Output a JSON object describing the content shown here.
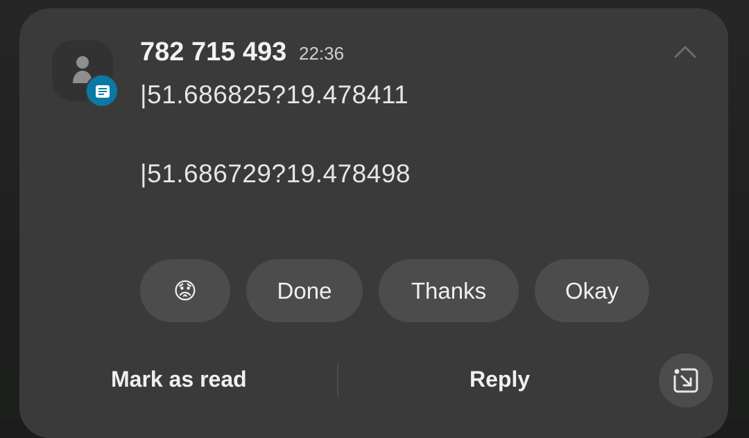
{
  "notification": {
    "sender": "782 715 493",
    "time": "22:36",
    "message_lines": [
      "|51.686825?19.478411",
      "|51.686729?19.478498"
    ],
    "icons": {
      "avatar": "person-icon",
      "app_badge": "message-icon",
      "collapse": "chevron-up-icon",
      "expand": "expand-arrow-icon"
    }
  },
  "smart_replies": [
    {
      "label": "😟",
      "name": "worried-face-emoji"
    },
    {
      "label": "Done"
    },
    {
      "label": "Thanks"
    },
    {
      "label": "Okay"
    }
  ],
  "actions": {
    "mark_as_read": "Mark as read",
    "reply": "Reply"
  },
  "colors": {
    "card_background": "#3a3a3a",
    "chip_background": "#4c4c4c",
    "badge_blue": "#0a7aa3",
    "text_primary": "#f2f2f2"
  }
}
